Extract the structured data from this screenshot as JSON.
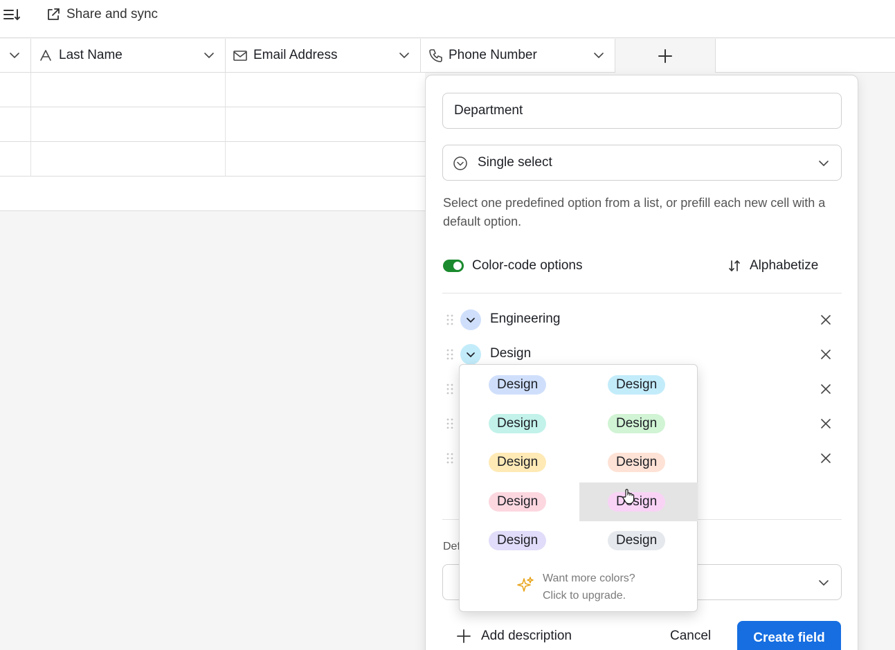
{
  "toolbar": {
    "share_label": "Share and sync"
  },
  "columns": [
    {
      "label": "Last Name",
      "icon": "text-a-icon"
    },
    {
      "label": "Email Address",
      "icon": "envelope-icon"
    },
    {
      "label": "Phone Number",
      "icon": "phone-icon"
    }
  ],
  "panel": {
    "field_name_value": "Department",
    "field_type": "Single select",
    "description": "Select one predefined option from a list, or prefill each new cell with a default option.",
    "color_code_label": "Color-code options",
    "color_code_on": true,
    "alphabetize_label": "Alphabetize",
    "options": [
      {
        "label": "Engineering",
        "color": "#cfdffb"
      },
      {
        "label": "Design",
        "color": "#c3ecfa"
      }
    ],
    "default_label": "Def",
    "add_description_label": "Add description",
    "cancel_label": "Cancel",
    "create_label": "Create field"
  },
  "color_picker": {
    "swatch_label": "Design",
    "swatches": [
      "#cfdffb",
      "#c3ecfa",
      "#c2f2ea",
      "#d1f4d4",
      "#ffeab6",
      "#fee2d5",
      "#fcd7e0",
      "#f9d3f6",
      "#e1dcf9",
      "#e5e8ec"
    ],
    "hovered_index": 7,
    "upgrade_line1": "Want more colors?",
    "upgrade_line2": "Click to upgrade."
  },
  "colors": {
    "accent": "#166ee1",
    "toggle_on": "#1b8a2e"
  }
}
